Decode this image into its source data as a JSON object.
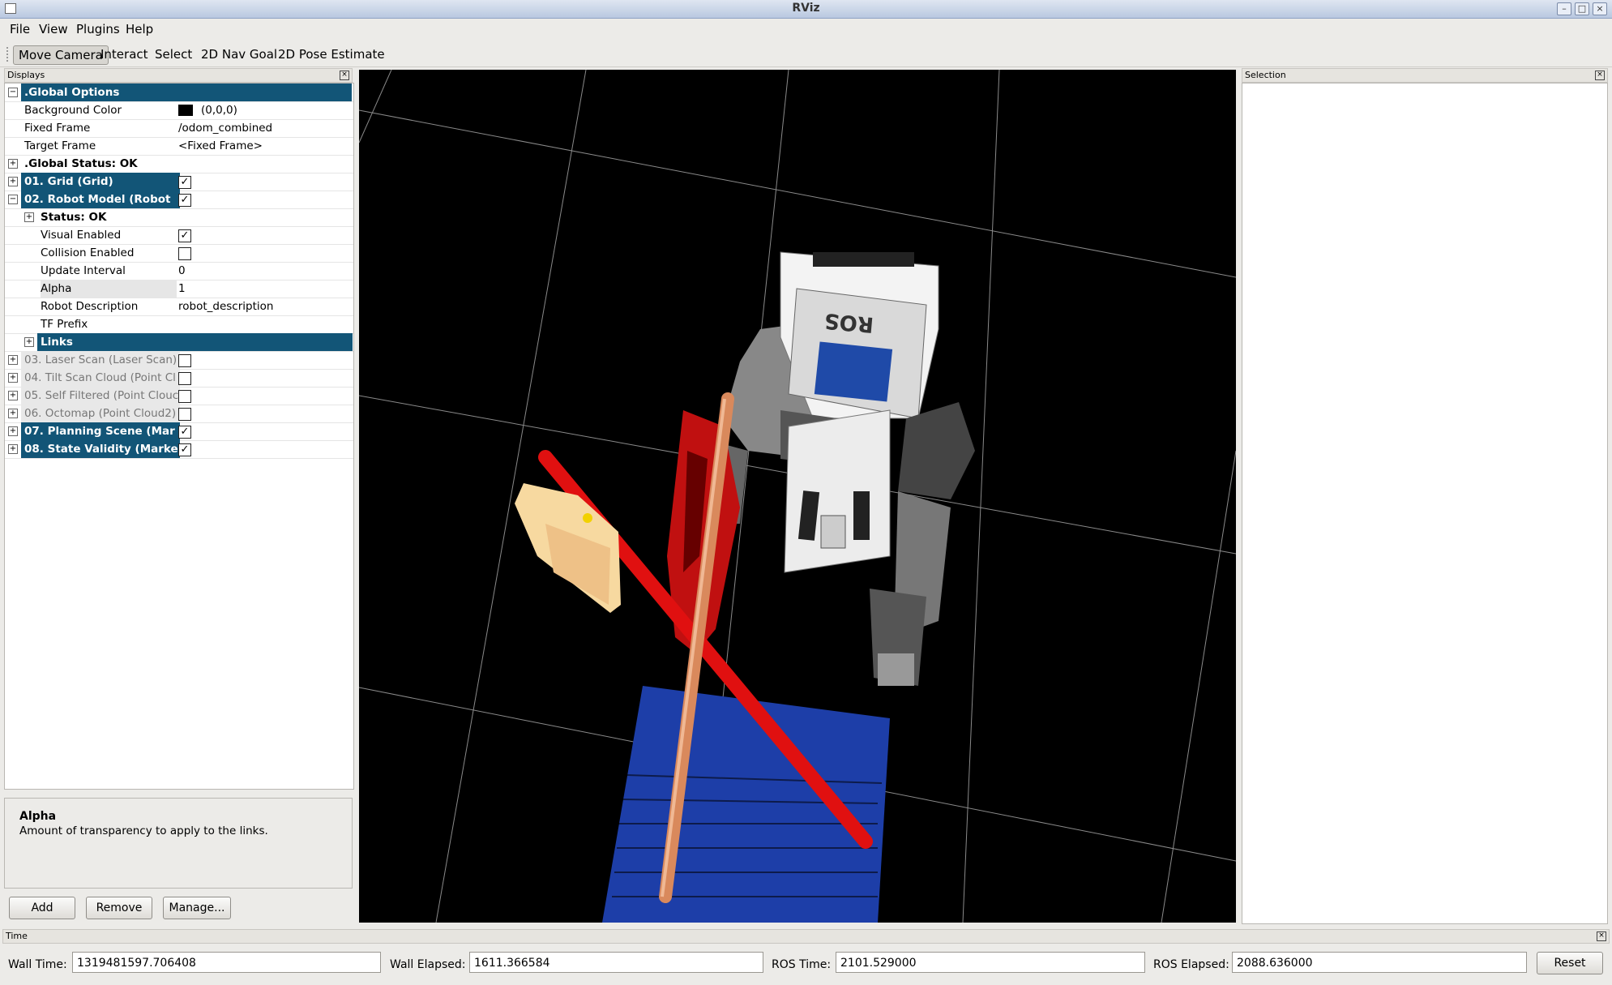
{
  "window": {
    "title": "RViz"
  },
  "menu": [
    "File",
    "View",
    "Plugins",
    "Help"
  ],
  "toolbar": {
    "tools": [
      "Move Camera",
      "Interact",
      "Select",
      "2D Nav Goal",
      "2D Pose Estimate"
    ],
    "active": "Move Camera"
  },
  "displays": {
    "panel_title": "Displays",
    "global_options": {
      "header": ".Global Options",
      "background_color_label": "Background Color",
      "background_color_value": "(0,0,0)",
      "background_color": "#000000",
      "fixed_frame_label": "Fixed Frame",
      "fixed_frame_value": "/odom_combined",
      "target_frame_label": "Target Frame",
      "target_frame_value": "<Fixed Frame>"
    },
    "global_status": ".Global Status: OK",
    "grid": {
      "label": "01. Grid (Grid)",
      "checked": true
    },
    "robot_model": {
      "label": "02. Robot Model (Robot",
      "checked": true,
      "status": "Status: OK",
      "visual_enabled_label": "Visual Enabled",
      "visual_enabled": true,
      "collision_enabled_label": "Collision Enabled",
      "collision_enabled": false,
      "update_interval_label": "Update Interval",
      "update_interval_value": "0",
      "alpha_label": "Alpha",
      "alpha_value": "1",
      "robot_description_label": "Robot Description",
      "robot_description_value": "robot_description",
      "tf_prefix_label": "TF Prefix",
      "tf_prefix_value": "",
      "links_label": "Links"
    },
    "laser_scan": {
      "label": "03. Laser Scan (Laser Scan)",
      "checked": false
    },
    "tilt_scan": {
      "label": "04. Tilt Scan Cloud (Point Cl",
      "checked": false
    },
    "self_filtered": {
      "label": "05. Self Filtered (Point Clouc",
      "checked": false
    },
    "octomap": {
      "label": "06. Octomap (Point Cloud2)",
      "checked": false
    },
    "planning_scene": {
      "label": "07. Planning Scene (Mar",
      "checked": true
    },
    "state_validity": {
      "label": "08. State Validity (Marke",
      "checked": true
    },
    "help_title": "Alpha",
    "help_text": "Amount of transparency to apply to the links.",
    "buttons": {
      "add": "Add",
      "remove": "Remove",
      "manage": "Manage..."
    }
  },
  "selection": {
    "panel_title": "Selection"
  },
  "viewport": {
    "robot_logo": "ROS"
  },
  "time": {
    "panel_title": "Time",
    "wall_time_label": "Wall Time:",
    "wall_time_value": "1319481597.706408",
    "wall_elapsed_label": "Wall Elapsed:",
    "wall_elapsed_value": "1611.366584",
    "ros_time_label": "ROS Time:",
    "ros_time_value": "2101.529000",
    "ros_elapsed_label": "ROS Elapsed:",
    "ros_elapsed_value": "2088.636000",
    "reset_label": "Reset"
  }
}
